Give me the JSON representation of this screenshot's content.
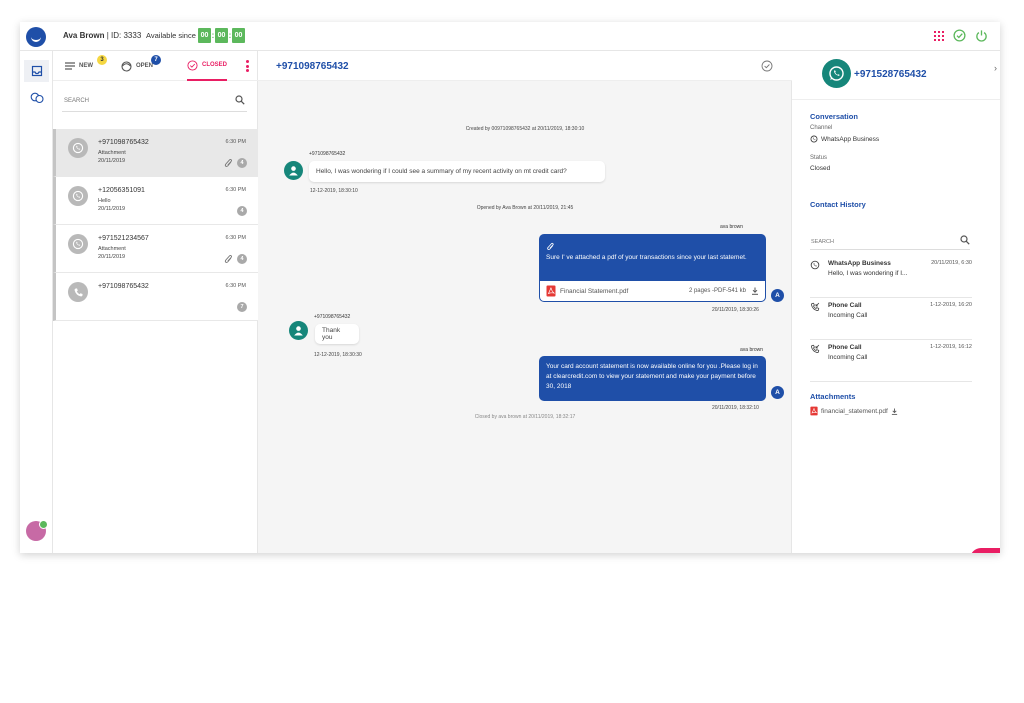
{
  "topbar": {
    "agent_name": "Ava Brown",
    "agent_id": "| ID: 3333",
    "available_label": "Available since",
    "timer": [
      "00",
      "00",
      "00"
    ]
  },
  "colors": {
    "brand_blue": "#1f4fa8",
    "accent_pink": "#e91e63",
    "whatsapp_teal": "#16867a",
    "timer_green": "#5cb85c"
  },
  "tabs": [
    {
      "label": "NEW",
      "badge": "3"
    },
    {
      "label": "OPEN",
      "badge": "7"
    },
    {
      "label": "CLOSED"
    }
  ],
  "search": {
    "placeholder": "SEARCH"
  },
  "conversations": [
    {
      "number": "+971098765432",
      "subtitle": "Attachment",
      "date": "20/11/2019",
      "time": "6:30 PM",
      "count": "4",
      "icon": "whatsapp-icon",
      "attachment": true
    },
    {
      "number": "+12056351091",
      "subtitle": "Hello",
      "date": "20/11/2019",
      "time": "6:30 PM",
      "count": "4",
      "icon": "whatsapp-icon",
      "attachment": false
    },
    {
      "number": "+971521234567",
      "subtitle": "Attachment",
      "date": "20/11/2019",
      "time": "6:30 PM",
      "count": "4",
      "icon": "whatsapp-icon",
      "attachment": true
    },
    {
      "number": "+971098765432",
      "subtitle": "",
      "date": "",
      "time": "6:30 PM",
      "count": "7",
      "icon": "phone-icon",
      "attachment": false
    }
  ],
  "chat": {
    "title": "+971098765432",
    "created_note": "Created by 00971098765432 at 20/11/2019, 18:30:10",
    "msg1": {
      "sender": "+971098765432",
      "text": "Hello, I was wondering if I could see a summary of my recent activity on mt credit card?",
      "time": "12-12-2019, 18:30:10"
    },
    "opened_note": "Opened by Ava Brown at 20/11/2019, 21:45",
    "msg2": {
      "sender": "ava brown",
      "text": "Sure I' ve attached a pdf of your transactions since your last statemet.",
      "file_name": "Financial Statement.pdf",
      "file_meta": "2 pages -PDF-541 kb",
      "time": "20/11/2019, 18:30:26",
      "avatar": "A"
    },
    "msg3": {
      "sender": "+971098765432",
      "text": "Thank you",
      "time": "12-12-2019, 18:30:30"
    },
    "msg4": {
      "sender": "ava brown",
      "text": "Your card account statement is now available online for you .Please log in at clearcredit.com to view your statement and make your payment before 30, 2018",
      "time": "20/11/2019, 18:32:10",
      "avatar": "A"
    },
    "closed_note": "Closed by ava brown at 20/11/2019, 18:32:17"
  },
  "details": {
    "number": "+971528765432",
    "conversation_heading": "Conversation",
    "channel_label": "Channel",
    "channel_value": "WhatsApp Business",
    "status_label": "Status",
    "status_value": "Closed",
    "history_heading": "Contact History",
    "search_placeholder": "SEARCH",
    "history": [
      {
        "title": "WhatsApp Business",
        "sub": "Hello, I was wondering if I...",
        "date": "20/11/2019, 6:30",
        "icon": "whatsapp-icon"
      },
      {
        "title": "Phone Call",
        "sub": "Incoming Call",
        "date": "1-12-2019, 16:20",
        "icon": "phone-incoming-icon"
      },
      {
        "title": "Phone Call",
        "sub": "Incoming Call",
        "date": "1-12-2019, 16:12",
        "icon": "phone-incoming-icon"
      }
    ],
    "attachments_heading": "Attachments",
    "attachment_file": "financial_statement.pdf"
  }
}
